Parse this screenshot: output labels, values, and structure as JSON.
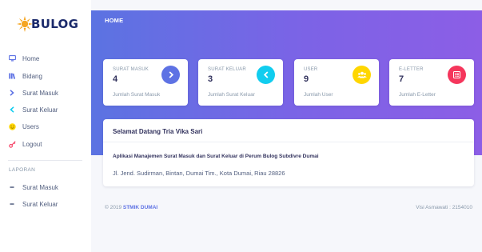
{
  "brand": {
    "logo_text": "BULOG"
  },
  "sidebar": {
    "items": [
      {
        "label": "Home",
        "icon": "monitor-icon",
        "color": "#5e72e4"
      },
      {
        "label": "Bidang",
        "icon": "books-icon",
        "color": "#5e72e4"
      },
      {
        "label": "Surat Masuk",
        "icon": "chevron-right-icon",
        "color": "#5e72e4"
      },
      {
        "label": "Surat Keluar",
        "icon": "chevron-left-icon",
        "color": "#11cdef"
      },
      {
        "label": "Users",
        "icon": "smile-icon",
        "color": "#ffd600"
      },
      {
        "label": "Logout",
        "icon": "key-icon",
        "color": "#f5365c"
      }
    ],
    "section_label": "LAPORAN",
    "report_items": [
      {
        "label": "Surat Masuk",
        "icon": "dash-icon"
      },
      {
        "label": "Surat Keluar",
        "icon": "dash-icon"
      }
    ]
  },
  "header": {
    "breadcrumb": "HOME"
  },
  "cards": [
    {
      "title": "SURAT MASUK",
      "value": "4",
      "subtitle": "Jumlah Surat Masuk",
      "icon": "chevron-right-icon",
      "color": "#5e72e4"
    },
    {
      "title": "SURAT KELUAR",
      "value": "3",
      "subtitle": "Jumlah Surat Keluar",
      "icon": "chevron-left-icon",
      "color": "#11cdef"
    },
    {
      "title": "USER",
      "value": "9",
      "subtitle": "Jumlah User",
      "icon": "users-icon",
      "color": "#ffd600"
    },
    {
      "title": "E-LETTER",
      "value": "7",
      "subtitle": "Jumlah E-Letter",
      "icon": "list-icon",
      "color": "#f5365c"
    }
  ],
  "welcome": {
    "title": "Selamat Datang Tria Vika Sari",
    "app_name": "Aplikasi Manajemen Surat Masuk dan Surat Keluar di Perum Bulog Subdivre Dumai",
    "address": "Jl. Jend. Sudirman, Bintan, Dumai Tim., Kota Dumai, Riau 28826"
  },
  "footer": {
    "copyright": "© 2019",
    "link": "STMIK DUMAI",
    "right": "Visi Asmawati : 2154010"
  }
}
